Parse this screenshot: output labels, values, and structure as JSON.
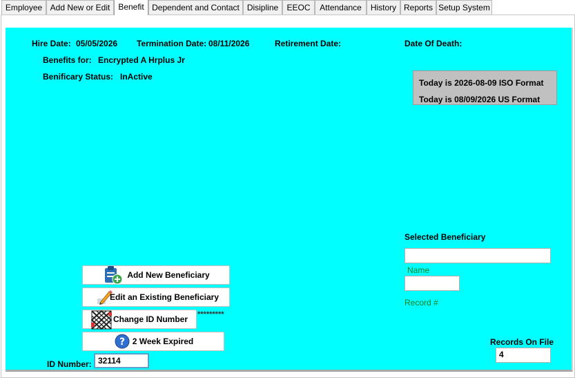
{
  "tabs": [
    {
      "label": "Employee"
    },
    {
      "label": "Add New or Edit"
    },
    {
      "label": "Benefit"
    },
    {
      "label": "Dependent and Contact"
    },
    {
      "label": "Disipline"
    },
    {
      "label": "EEOC"
    },
    {
      "label": "Attendance"
    },
    {
      "label": "History"
    },
    {
      "label": "Reports"
    },
    {
      "label": "Setup System"
    }
  ],
  "info": {
    "hire_date_label": "Hire Date:",
    "hire_date": "05/05/2026",
    "termination_label": "Termination Date:",
    "termination_date": "08/11/2026",
    "retirement_label": "Retirement Date:",
    "death_label": "Date Of Death:",
    "benefits_for_label": "Benefits for:",
    "benefits_for": "Encrypted A Hrplus Jr",
    "status_label": "Benificary Status:",
    "status": "InActive"
  },
  "today": {
    "iso": "Today is 2026-08-09 ISO Format",
    "us": "Today is 08/09/2026 US Format"
  },
  "selected": {
    "title": "Selected Beneficiary",
    "name_label": "Name",
    "name_value": "",
    "record_label": "Record #",
    "record_value": ""
  },
  "buttons": {
    "add": "Add New Beneficiary",
    "edit": "Edit an Existing Beneficiary",
    "change_id": "Change ID Number",
    "expired": "2 Week Expired"
  },
  "masked": "*********",
  "id_number": {
    "label": "ID Number:",
    "value": "32114"
  },
  "records": {
    "label": "Records On File",
    "value": "4"
  },
  "colors": {
    "background": "#00ffff",
    "label_green": "#1e7d1e",
    "date_box": "#c0c0c0"
  },
  "icons": [
    "clipboard-add-icon",
    "pencil-icon",
    "id-card-icon",
    "help-question-icon"
  ]
}
